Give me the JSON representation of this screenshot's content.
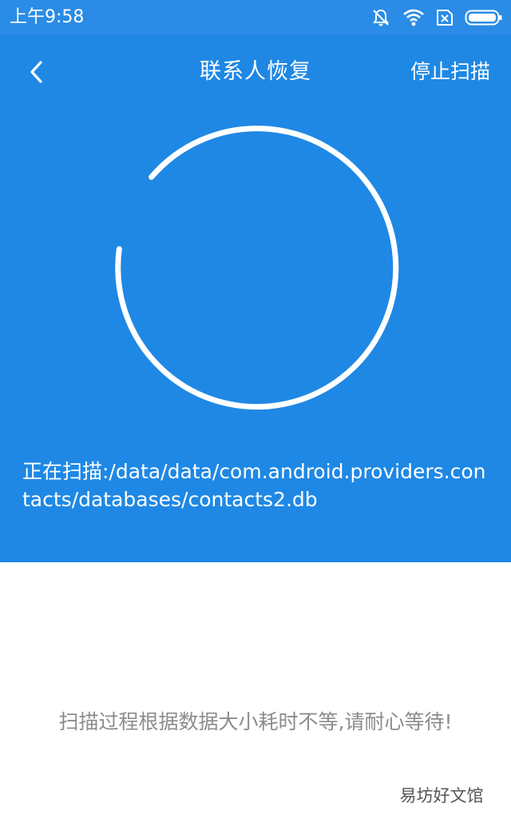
{
  "status_bar": {
    "time": "上午9:58",
    "icons": [
      "muted-bell-icon",
      "wifi-icon",
      "no-sim-icon",
      "battery-icon"
    ]
  },
  "header": {
    "title": "联系人恢复",
    "back_icon": "chevron-left-icon",
    "stop_label": "停止扫描"
  },
  "scan": {
    "status_text": "正在扫描:/data/data/com.android.providers.contacts/databases/contacts2.db"
  },
  "hint": "扫描过程根据数据大小耗时不等,请耐心等待!",
  "watermark": "易坊好文馆",
  "colors": {
    "primary": "#1f88e5",
    "status_bar": "#2a8ce6",
    "hint_text": "#8c8c8c"
  }
}
